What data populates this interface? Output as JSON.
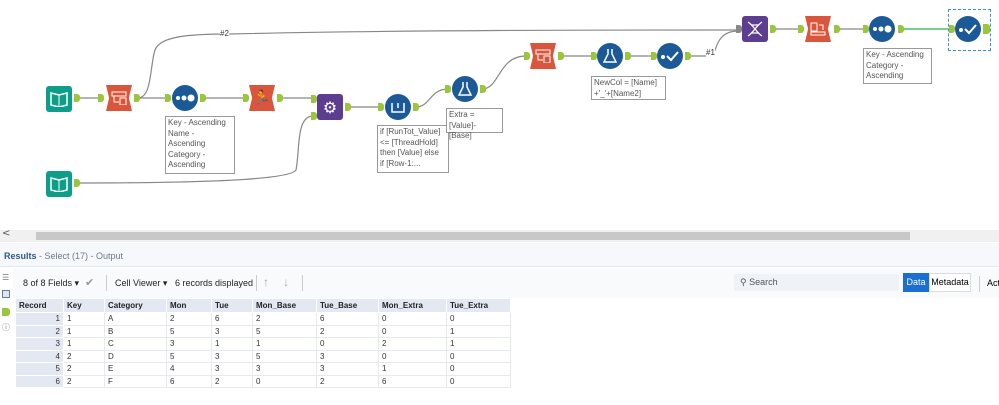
{
  "canvas": {
    "wire_labels": [
      "#2",
      "#1"
    ],
    "tools": [
      {
        "name": "input-data-1",
        "icon": "book-icon"
      },
      {
        "name": "input-data-2",
        "icon": "book-icon"
      },
      {
        "name": "crosstab-1",
        "icon": "crosstab-icon"
      },
      {
        "name": "sort-1",
        "icon": "sort-icon"
      },
      {
        "name": "running-total",
        "icon": "runner-icon"
      },
      {
        "name": "macro",
        "icon": "gears-icon"
      },
      {
        "name": "multi-row-formula",
        "icon": "multirow-icon"
      },
      {
        "name": "formula-1",
        "icon": "flask-icon"
      },
      {
        "name": "crosstab-2",
        "icon": "crosstab-icon"
      },
      {
        "name": "formula-2",
        "icon": "flask-icon"
      },
      {
        "name": "select-1",
        "icon": "select-icon"
      },
      {
        "name": "join",
        "icon": "dna-icon"
      },
      {
        "name": "transpose",
        "icon": "transpose-icon"
      },
      {
        "name": "sort-2",
        "icon": "sort-icon"
      },
      {
        "name": "select-17",
        "icon": "select-icon"
      }
    ],
    "annotations": {
      "sort1": "Key - Ascending\nName -\nAscending\nCategory -\nAscending",
      "multirow": "if [RunTot_Value]\n<= [ThreadHold]\nthen [Value] else\nif [Row-1:...",
      "formula1": "Extra = [Value]-\n[Base]",
      "formula2": "NewCol = [Name]\n+'_'+[Name2]",
      "sort2": "Key - Ascending\nCategory -\nAscending"
    },
    "connection_highlight_color": "#2bb24c"
  },
  "results": {
    "title": "Results",
    "subtitle": " - Select (17) - Output",
    "fields_label": "8 of 8 Fields",
    "viewer_label": "Cell Viewer",
    "records_label": "6 records displayed",
    "search_placeholder": "Search",
    "data_tab": "Data",
    "metadata_tab": "Metadata",
    "actions_label": "Act",
    "columns": [
      "Record",
      "Key",
      "Category",
      "Mon",
      "Tue",
      "Mon_Base",
      "Tue_Base",
      "Mon_Extra",
      "Tue_Extra"
    ],
    "rows": [
      [
        "1",
        "1",
        "A",
        "2",
        "6",
        "2",
        "6",
        "0",
        "0"
      ],
      [
        "2",
        "1",
        "B",
        "5",
        "3",
        "5",
        "2",
        "0",
        "1"
      ],
      [
        "3",
        "1",
        "C",
        "3",
        "1",
        "1",
        "0",
        "2",
        "1"
      ],
      [
        "4",
        "2",
        "D",
        "5",
        "3",
        "5",
        "3",
        "0",
        "0"
      ],
      [
        "5",
        "2",
        "E",
        "4",
        "3",
        "3",
        "3",
        "1",
        "0"
      ],
      [
        "6",
        "2",
        "F",
        "6",
        "2",
        "0",
        "2",
        "6",
        "0"
      ]
    ],
    "accent_color": "#1a6fd0"
  }
}
